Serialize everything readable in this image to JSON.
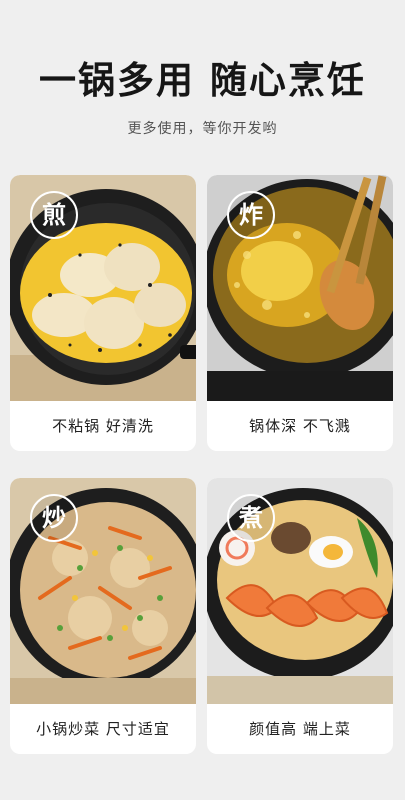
{
  "header": {
    "title": "一锅多用 随心烹饪",
    "subtitle": "更多使用，等你开发哟"
  },
  "cards": [
    {
      "badge": "煎",
      "caption": "不粘锅 好清洗"
    },
    {
      "badge": "炸",
      "caption": "锅体深 不飞溅"
    },
    {
      "badge": "炒",
      "caption": "小锅炒菜 尺寸适宜"
    },
    {
      "badge": "煮",
      "caption": "颜值高 端上菜"
    }
  ]
}
